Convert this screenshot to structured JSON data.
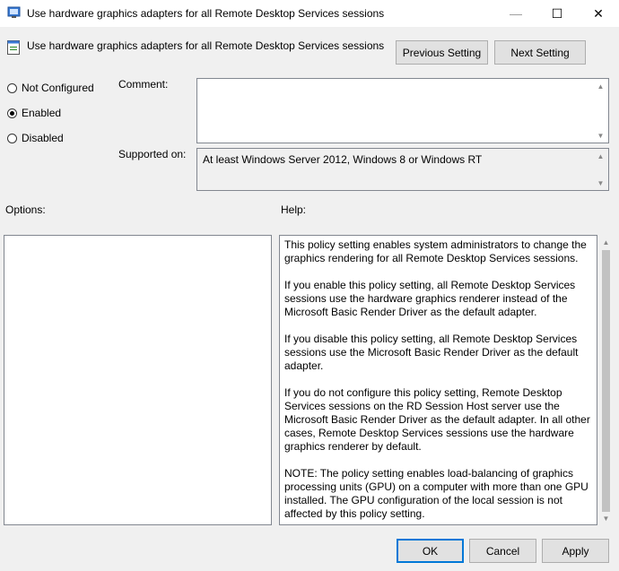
{
  "window": {
    "title": "Use hardware graphics adapters for all Remote Desktop Services sessions",
    "minimize_glyph": "—",
    "maximize_glyph": "☐",
    "close_glyph": "✕"
  },
  "header": {
    "policy_name": "Use hardware graphics adapters for all Remote Desktop Services sessions",
    "previous_label": "Previous Setting",
    "next_label": "Next Setting"
  },
  "state": {
    "options": [
      {
        "label": "Not Configured",
        "checked": false
      },
      {
        "label": "Enabled",
        "checked": true
      },
      {
        "label": "Disabled",
        "checked": false
      }
    ]
  },
  "comment": {
    "label": "Comment:",
    "value": ""
  },
  "supported": {
    "label": "Supported on:",
    "value": "At least Windows Server 2012, Windows 8 or Windows RT"
  },
  "options_panel": {
    "label": "Options:"
  },
  "help_panel": {
    "label": "Help:",
    "paragraphs": [
      "This policy setting enables system administrators to change the graphics rendering for all Remote Desktop Services sessions.",
      "If you enable this policy setting, all Remote Desktop Services sessions use the hardware graphics renderer instead of the Microsoft Basic Render Driver as the default adapter.",
      "If you disable this policy setting, all Remote Desktop Services sessions use the Microsoft Basic Render Driver as the default adapter.",
      "If you do not configure this policy setting, Remote Desktop Services sessions on the RD Session Host server use the Microsoft Basic Render Driver as the default adapter. In all other cases, Remote Desktop Services sessions use the hardware graphics renderer by default.",
      "NOTE: The policy setting enables load-balancing of graphics processing units (GPU) on a computer with more than one GPU installed. The GPU configuration of the local session is not affected by this policy setting."
    ]
  },
  "footer": {
    "ok_label": "OK",
    "cancel_label": "Cancel",
    "apply_label": "Apply"
  },
  "icons": {
    "app_icon": "policy-editor-icon",
    "policy_icon": "policy-setting-icon",
    "accent_color": "#0078d7"
  }
}
